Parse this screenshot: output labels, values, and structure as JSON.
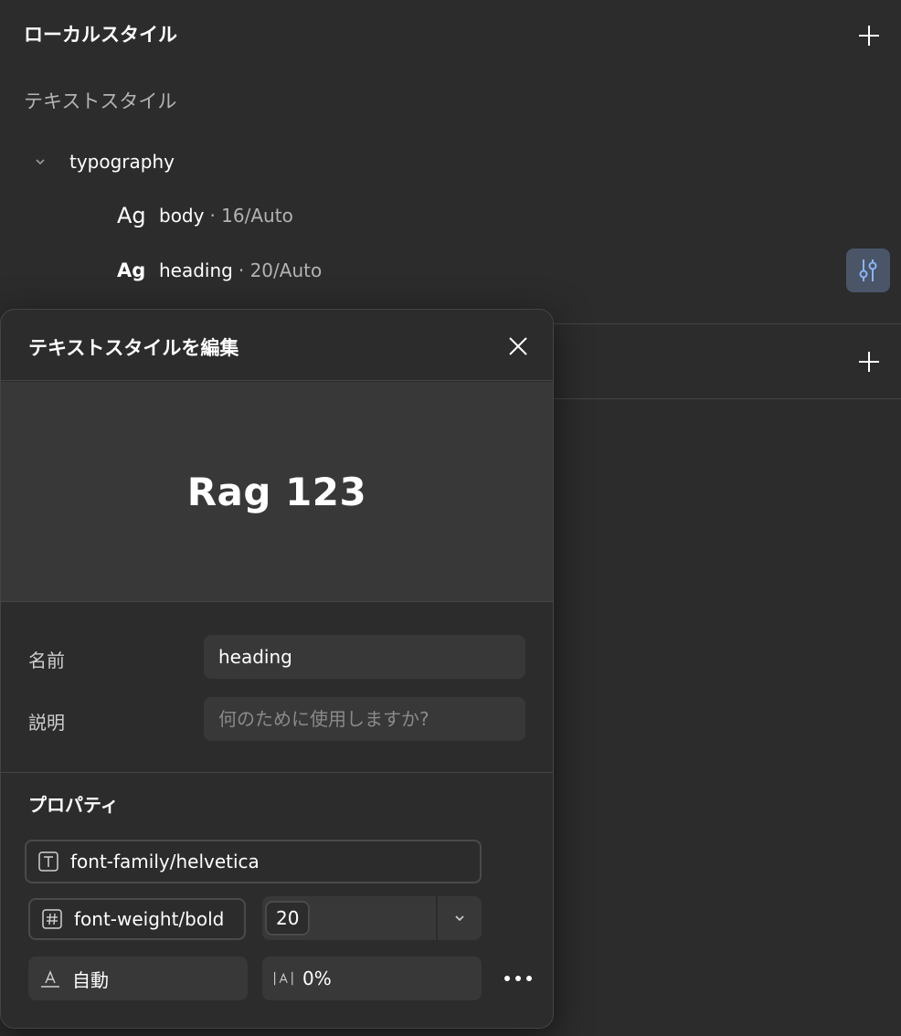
{
  "panel": {
    "title": "ローカルスタイル",
    "text_styles_heading": "テキストスタイル",
    "group": {
      "label": "typography",
      "expanded": true
    },
    "styles": [
      {
        "ag": "Ag",
        "name": "body",
        "meta": "· 16/Auto",
        "bold": false
      },
      {
        "ag": "Ag",
        "name": "heading",
        "meta": "· 20/Auto",
        "bold": true
      }
    ]
  },
  "modal": {
    "title": "テキストスタイルを編集",
    "preview_text": "Rag 123",
    "name_label": "名前",
    "name_value": "heading",
    "description_label": "説明",
    "description_placeholder": "何のために使用しますか?",
    "properties_title": "プロパティ",
    "font_family": "font-family/helvetica",
    "font_weight": "font-weight/bold",
    "font_size": "20",
    "line_height": "自動",
    "letter_spacing": "0%"
  },
  "colors": {
    "background": "#2c2c2c",
    "surface": "#383838",
    "accent_button": "#4a5568",
    "accent_icon": "#8ab4f8"
  }
}
